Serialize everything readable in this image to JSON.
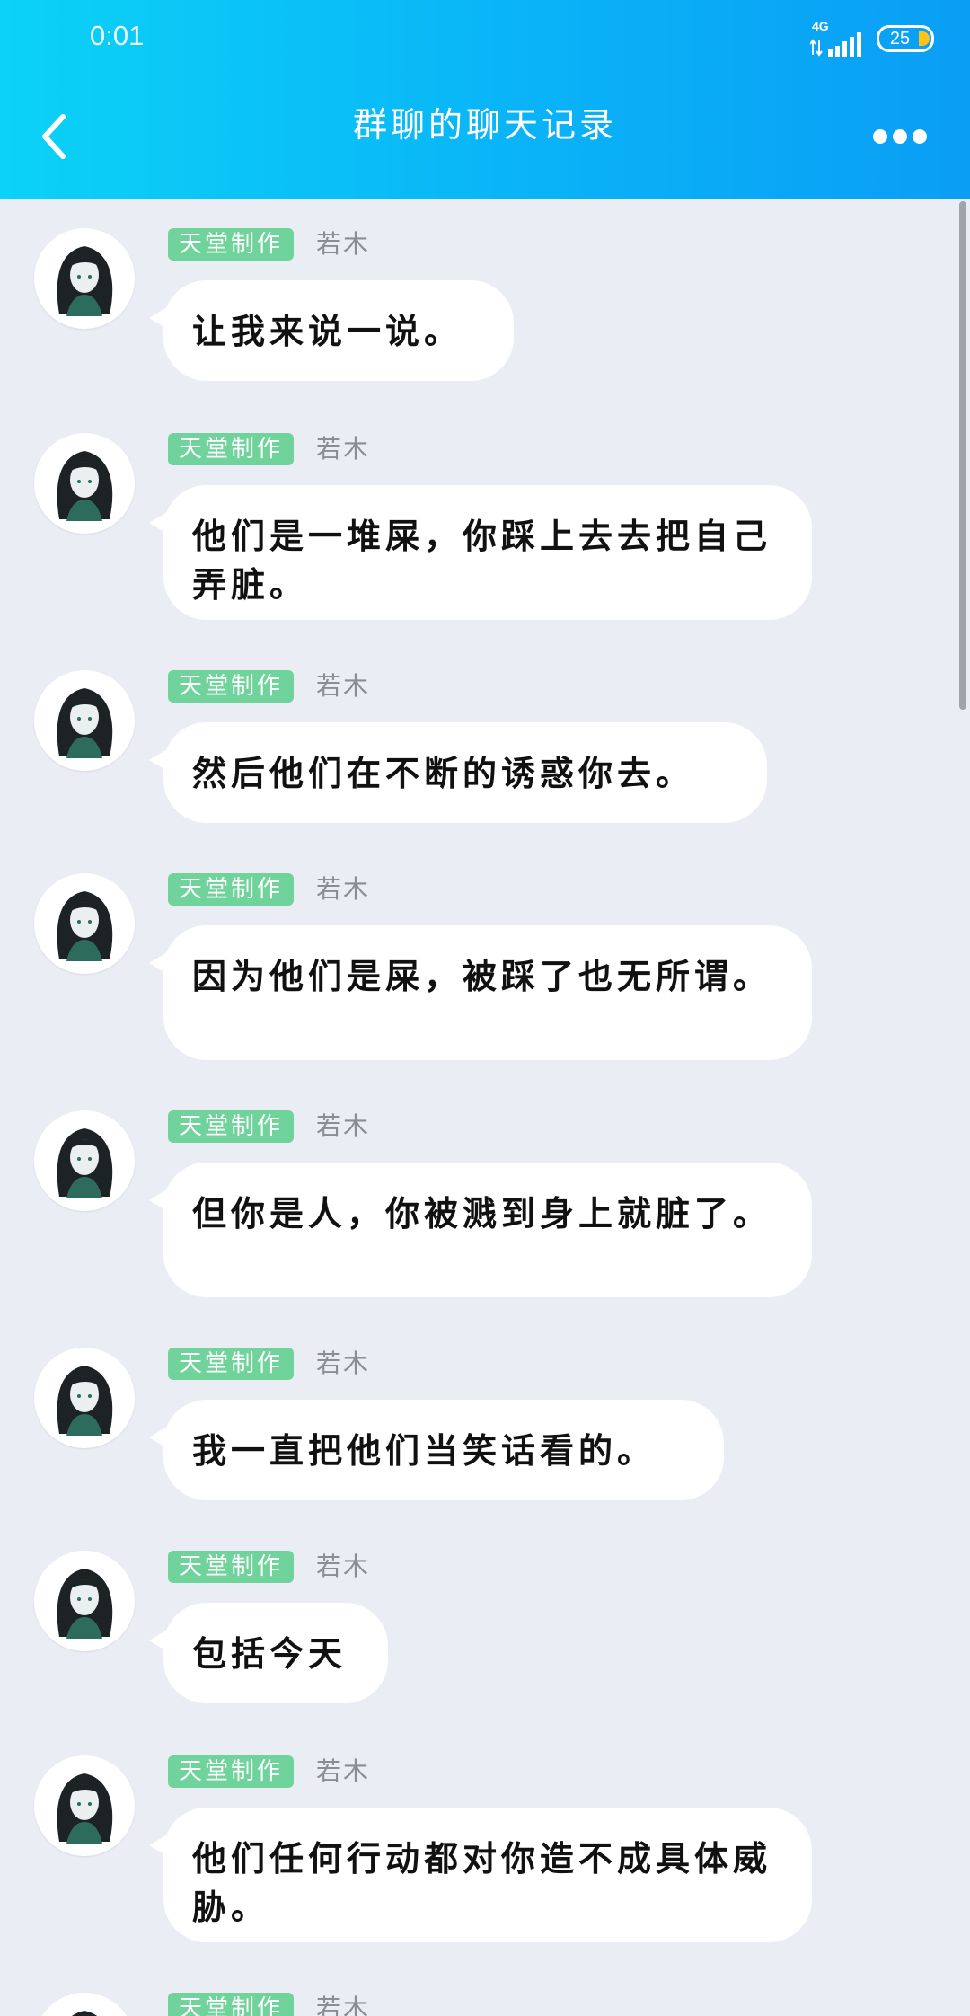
{
  "status_bar": {
    "time": "0:01",
    "network": "4G",
    "battery": "25"
  },
  "header": {
    "title": "群聊的聊天记录"
  },
  "messages": [
    {
      "tag": "天堂制作",
      "sender": "若木",
      "text": "让我来说一说。"
    },
    {
      "tag": "天堂制作",
      "sender": "若木",
      "text": "他们是一堆屎，你踩上去去把自己弄脏。"
    },
    {
      "tag": "天堂制作",
      "sender": "若木",
      "text": "然后他们在不断的诱惑你去。"
    },
    {
      "tag": "天堂制作",
      "sender": "若木",
      "text": "因为他们是屎，被踩了也无所谓。"
    },
    {
      "tag": "天堂制作",
      "sender": "若木",
      "text": "但你是人，你被溅到身上就脏了。"
    },
    {
      "tag": "天堂制作",
      "sender": "若木",
      "text": "我一直把他们当笑话看的。"
    },
    {
      "tag": "天堂制作",
      "sender": "若木",
      "text": "包括今天"
    },
    {
      "tag": "天堂制作",
      "sender": "若木",
      "text": "他们任何行动都对你造不成具体威胁。"
    },
    {
      "tag": "天堂制作",
      "sender": "若木",
      "text": ""
    }
  ],
  "colors": {
    "header_start": "#0bd2f7",
    "header_end": "#0a9ef5",
    "tag_bg": "#6fd39b",
    "page_bg": "#ebedf5"
  }
}
